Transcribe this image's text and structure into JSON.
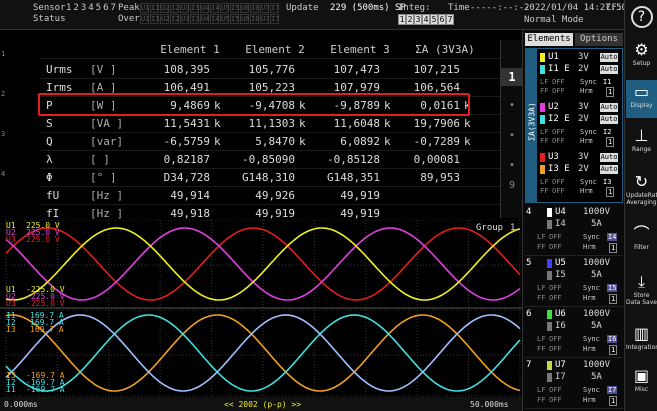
{
  "topbar": {
    "sensor_label": "Sensor",
    "status_label": "Status",
    "sensor_nums": "1234567",
    "peak_label": "Peak",
    "over_label": "Over",
    "peak_items": [
      "U1",
      "I1",
      "U2",
      "I2",
      "U3",
      "I3",
      "U4",
      "I4",
      "U5",
      "I5",
      "U6",
      "I6",
      "U7",
      "I7"
    ],
    "update_label": "Update",
    "update_value": "229 (500ms) SP",
    "integ_label": "Integ:",
    "integ_nums": "1234567",
    "time_label": "Time",
    "time_value": "-----:--:--",
    "datetime": "2022/01/04  14:27:50",
    "cf_value": "CF:3",
    "mode": "Normal Mode"
  },
  "left_tab": [
    "1",
    "2",
    "3",
    "4"
  ],
  "numeric": {
    "headers": [
      "Element 1",
      "Element 2",
      "Element 3",
      "ΣA (3V3A)"
    ],
    "rows": [
      {
        "label": "Urms",
        "unit": "[V  ]",
        "values": [
          "108,395",
          "105,776",
          "107,473",
          "107,215"
        ],
        "suffix": [
          "",
          "",
          "",
          ""
        ]
      },
      {
        "label": "Irms",
        "unit": "[A  ]",
        "values": [
          "106,491",
          "105,223",
          "107,979",
          "106,564"
        ],
        "suffix": [
          "",
          "",
          "",
          ""
        ]
      },
      {
        "label": "P",
        "unit": "[W  ]",
        "values": [
          "9,4869",
          "-9,4708",
          "-9,8789",
          "0,0161"
        ],
        "suffix": [
          "k",
          "k",
          "k",
          "k"
        ]
      },
      {
        "label": "S",
        "unit": "[VA ]",
        "values": [
          "11,5431",
          "11,1303",
          "11,6048",
          "19,7906"
        ],
        "suffix": [
          "k",
          "k",
          "k",
          "k"
        ]
      },
      {
        "label": "Q",
        "unit": "[var]",
        "values": [
          "-6,5759",
          "5,8470",
          "6,0892",
          "-0,7289"
        ],
        "suffix": [
          "k",
          "k",
          "k",
          "k"
        ]
      },
      {
        "label": "λ",
        "unit": "[   ]",
        "values": [
          "0,82187",
          "-0,85090",
          "-0,85128",
          "0,00081"
        ],
        "suffix": [
          "",
          "",
          "",
          ""
        ]
      },
      {
        "label": "Φ",
        "unit": "[°  ]",
        "values": [
          "D34,728",
          "G148,310",
          "G148,351",
          "89,953"
        ],
        "suffix": [
          "",
          "",
          "",
          ""
        ]
      },
      {
        "label": "fU",
        "unit": "[Hz ]",
        "values": [
          "49,914",
          "49,926",
          "49,919",
          ""
        ],
        "suffix": [
          "",
          "",
          "",
          ""
        ]
      },
      {
        "label": "fI",
        "unit": "[Hz ]",
        "values": [
          "49,918",
          "49,919",
          "49,919",
          ""
        ],
        "suffix": [
          "",
          "",
          "",
          ""
        ]
      }
    ],
    "pages": [
      "1",
      "9"
    ]
  },
  "waveform": {
    "group_label": "Group",
    "group_num": "1",
    "u_labels": [
      {
        "name": "U1",
        "value": "225.0 V",
        "color": "#f0f020"
      },
      {
        "name": "U2",
        "value": "225.0 V",
        "color": "#e040e0"
      },
      {
        "name": "U3",
        "value": "225.0 V",
        "color": "#e02020"
      }
    ],
    "u_neg_labels": [
      {
        "name": "U1",
        "value": "-225.0 V",
        "color": "#f0f020"
      },
      {
        "name": "U2",
        "value": "-225.0 V",
        "color": "#e040e0"
      },
      {
        "name": "U3",
        "value": "-225.0 V",
        "color": "#e02020"
      }
    ],
    "i_labels": [
      {
        "name": "I1",
        "value": "169.7 A",
        "color": "#40e0e0"
      },
      {
        "name": "I2",
        "value": "169.7 A",
        "color": "#40e0e0"
      },
      {
        "name": "I3",
        "value": "169.7 A",
        "color": "#f0a020"
      }
    ],
    "i_neg_labels": [
      {
        "name": "I3",
        "value": "-169.7 A",
        "color": "#f0a020"
      },
      {
        "name": "I2",
        "value": "-169.7 A",
        "color": "#40e0e0"
      },
      {
        "name": "I1",
        "value": "-169.7 A",
        "color": "#40e0e0"
      }
    ],
    "time_start": "0.000ms",
    "time_end": "50.000ms",
    "points_label": "<< 2002 (p-p) >>",
    "colors": {
      "u1": "#f0f020",
      "u2": "#e040e0",
      "u3": "#e02020",
      "i1": "#40e0e0",
      "i2": "#a0c0ff",
      "i3": "#f0a020"
    }
  },
  "elements_panel": {
    "tabs": [
      "Elements",
      "Options"
    ],
    "sigma_label": "ΣA(3V3A)",
    "group_elements": [
      {
        "u": "U1",
        "urange": "3V",
        "i": "I1 E",
        "irange": "2V",
        "auto": "Auto",
        "ucolor": "#f0f020",
        "icolor": "#40e0e0"
      },
      {
        "u": "U2",
        "urange": "3V",
        "i": "I2 E",
        "irange": "2V",
        "auto": "Auto",
        "ucolor": "#e040e0",
        "icolor": "#40e0e0"
      },
      {
        "u": "U3",
        "urange": "3V",
        "i": "I3 E",
        "irange": "2V",
        "auto": "Auto",
        "ucolor": "#e02020",
        "icolor": "#f0a020"
      }
    ],
    "lf_label": "LF",
    "ff_label": "FF",
    "off_label": "OFF",
    "sync_label": "Sync",
    "hrm_label": "Hrm",
    "sync_vals": [
      "I1",
      "I2",
      "I3"
    ],
    "hrm_val": "1",
    "single_elements": [
      {
        "num": "4",
        "u": "U4",
        "urange": "1000V",
        "i": "I4",
        "irange": "5A",
        "color": "#ffffff",
        "sync": "I4"
      },
      {
        "num": "5",
        "u": "U5",
        "urange": "1000V",
        "i": "I5",
        "irange": "5A",
        "color": "#4040ff",
        "sync": "I5"
      },
      {
        "num": "6",
        "u": "U6",
        "urange": "1000V",
        "i": "I6",
        "irange": "5A",
        "color": "#40e040",
        "sync": "I6"
      },
      {
        "num": "7",
        "u": "U7",
        "urange": "1000V",
        "i": "I7",
        "irange": "5A",
        "color": "#c0e040",
        "sync": "I7"
      }
    ]
  },
  "right_menu": [
    {
      "name": "help",
      "label": "",
      "glyph": "?"
    },
    {
      "name": "setup",
      "label": "Setup",
      "glyph": "⚙"
    },
    {
      "name": "display",
      "label": "Display",
      "glyph": "▭"
    },
    {
      "name": "range",
      "label": "Range",
      "glyph": "⊥"
    },
    {
      "name": "update-rate",
      "label": "UpdateRate Averaging",
      "glyph": "↻"
    },
    {
      "name": "filter",
      "label": "Filter",
      "glyph": "⌒"
    },
    {
      "name": "store",
      "label": "Store Data Save",
      "glyph": "⤓"
    },
    {
      "name": "integration",
      "label": "Integration",
      "glyph": "▥"
    },
    {
      "name": "misc",
      "label": "Misc",
      "glyph": "▣"
    }
  ]
}
